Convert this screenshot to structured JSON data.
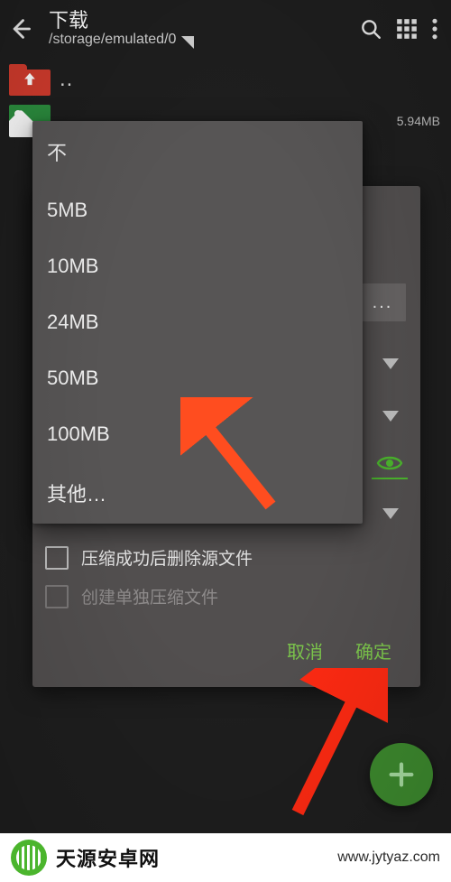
{
  "header": {
    "title": "下载",
    "path": "/storage/emulated/0"
  },
  "files": {
    "up_label": "..",
    "item_size": "5.94MB"
  },
  "dialog": {
    "split_selected": "不",
    "check_delete_label": "压缩成功后删除源文件",
    "check_single_label": "创建单独压缩文件",
    "cancel": "取消",
    "ok": "确定"
  },
  "popup": {
    "items": [
      "不",
      "5MB",
      "10MB",
      "24MB",
      "50MB",
      "100MB",
      "其他…"
    ]
  },
  "watermark": {
    "title": "天源安卓网",
    "url": "www.jytyaz.com"
  }
}
